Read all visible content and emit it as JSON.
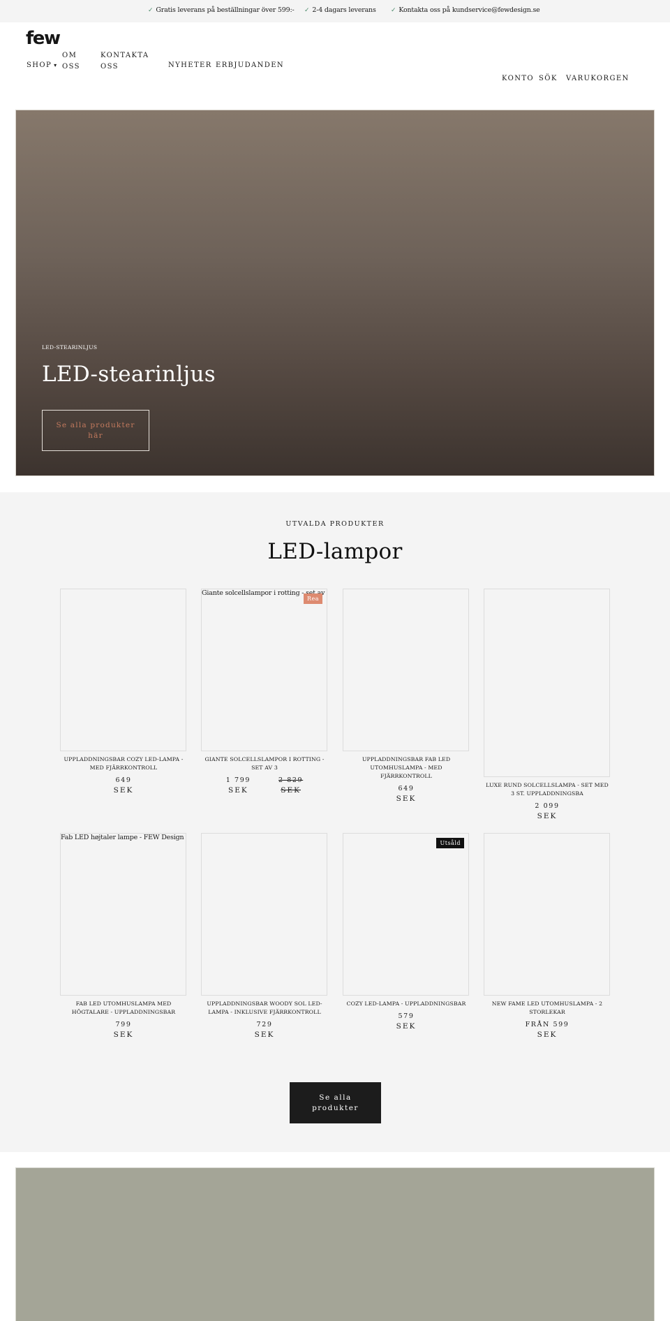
{
  "announcement": {
    "items": [
      {
        "icon": "check-icon",
        "text": "Gratis leverans på beställningar över 599:-"
      },
      {
        "icon": "check-icon",
        "text": "2-4 dagars leverans"
      },
      {
        "icon": "check-icon",
        "text": "Kontakta oss på kundservice@fewdesign.se"
      }
    ],
    "check_glyph": "✓",
    "check_color": "#4a8a6a"
  },
  "header": {
    "logo": "few",
    "nav": {
      "shop": "SHOP",
      "shop_caret": "▾",
      "om_oss": "OM OSS",
      "kontakta_oss": "KONTAKTA OSS",
      "nyheter": "NYHETER",
      "erbjudanden": "ERBJUDANDEN"
    },
    "utility": {
      "konto": "KONTO",
      "sok": "SÖK",
      "varukorgen": "VARUKORGEN"
    }
  },
  "hero": {
    "eyebrow": "LED-STEARINLJUS",
    "title": "LED-stearinljus",
    "button": "Se alla produkter här",
    "button_color": "#c47a5e"
  },
  "featured": {
    "eyebrow": "UTVALDA PRODUKTER",
    "title": "LED-lampor",
    "products": [
      {
        "name": "UPPLADDNINGSBAR COZY LED-LAMPA - MED FJÄRRKONTROLL",
        "price": "649",
        "currency": "SEK",
        "image_alt": "",
        "badge": ""
      },
      {
        "name": "GIANTE SOLCELLSLAMPOR I ROTTING - SET AV 3",
        "price": "1 799",
        "currency": "SEK",
        "compare_price": "2 829",
        "compare_currency": "SEK",
        "image_alt": "Giante solcellslampor i rotting - set av 3",
        "badge": "Rea"
      },
      {
        "name": "UPPLADDNINGSBAR FAB LED UTOMHUSLAMPA - MED FJÄRRKONTROLL",
        "price": "649",
        "currency": "SEK",
        "image_alt": "",
        "badge": ""
      },
      {
        "name": "LUXE RUND SOLCELLSLAMPA - SET MED 3 ST. UPPLADDNINGSBA",
        "price": "2 099",
        "currency": "SEK",
        "image_alt": "",
        "badge": ""
      },
      {
        "name": "FAB LED UTOMHUSLAMPA MED HÖGTALARE - UPPLADDNINGSBAR",
        "price": "799",
        "currency": "SEK",
        "image_alt": "Fab LED højtaler lampe - FEW Design",
        "badge": ""
      },
      {
        "name": "UPPLADDNINGSBAR WOODY SOL LED-LAMPA - INKLUSIVE FJÄRRKONTROLL",
        "price": "729",
        "currency": "SEK",
        "image_alt": "",
        "badge": ""
      },
      {
        "name": "COZY LED-LAMPA - UPPLADDNINGSBAR",
        "price": "579",
        "currency": "SEK",
        "image_alt": "",
        "badge": "Utsåld"
      },
      {
        "name": "NEW FAME LED UTOMHUSLAMPA - 2 STORLEKAR",
        "price": "FRÅN 599",
        "currency": "SEK",
        "image_alt": "",
        "badge": ""
      }
    ],
    "all_button": "Se alla produkter",
    "sale_badge_color": "#dd8a70",
    "sold_badge_color": "#111111"
  },
  "colors": {
    "hero_top": "#86786b",
    "hero_bottom": "#3c332e",
    "section_bg": "#f4f4f4",
    "banner_bg": "#a4a597"
  }
}
